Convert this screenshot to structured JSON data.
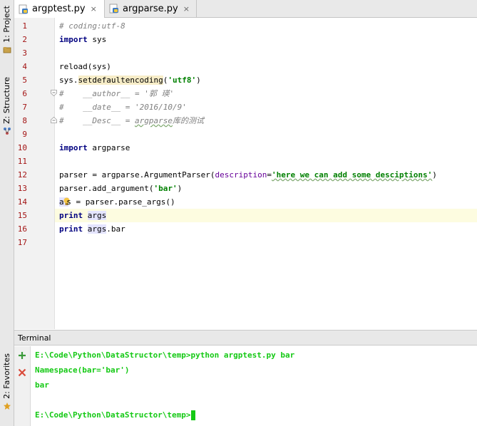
{
  "sidebar": {
    "project_label": "1: Project",
    "structure_label": "Z: Structure",
    "favorites_label": "2: Favorites"
  },
  "tabs": [
    {
      "label": "argptest.py",
      "active": true
    },
    {
      "label": "argparse.py",
      "active": false
    }
  ],
  "tab_close_glyph": "×",
  "editor": {
    "line_numbers": [
      "1",
      "2",
      "3",
      "4",
      "5",
      "6",
      "7",
      "8",
      "9",
      "10",
      "11",
      "12",
      "13",
      "14",
      "15",
      "16",
      "17"
    ],
    "l1": "# coding:utf-8",
    "l2_kw": "import",
    "l2_rest": " sys",
    "l4": "reload(sys)",
    "l5_a": "sys.",
    "l5_fn": "setdefaultencoding",
    "l5_b": "(",
    "l5_str": "'utf8'",
    "l5_c": ")",
    "l6": "#    __author__ = '郭 瑛'",
    "l7": "#    __date__ = '2016/10/9'",
    "l8_a": "#    __Desc__ = ",
    "l8_b": "argparse",
    "l8_c": "库的测试",
    "l10_kw": "import",
    "l10_rest": " argparse",
    "l12_a": "parser = argparse.ArgumentParser(",
    "l12_param": "description",
    "l12_b": "=",
    "l12_str": "'here we can add some desciptions'",
    "l12_c": ")",
    "l13_a": "parser.add_argument(",
    "l13_str": "'bar'",
    "l13_b": ")",
    "l14_a": "ar",
    "l14_b": "s = parser.parse_args()",
    "l15_kw": "print",
    "l15_var": "args",
    "l16_kw": "print",
    "l16_var": "args",
    "l16_rest": ".bar"
  },
  "terminal": {
    "title": "Terminal",
    "lines": [
      "E:\\Code\\Python\\DataStructor\\temp>python argptest.py bar",
      "Namespace(bar='bar')",
      "bar",
      "",
      "E:\\Code\\Python\\DataStructor\\temp>"
    ]
  },
  "colors": {
    "keyword": "#000080",
    "string": "#008000",
    "comment": "#808080",
    "terminal_text": "#14c914",
    "caret_line": "#fdfce0"
  }
}
